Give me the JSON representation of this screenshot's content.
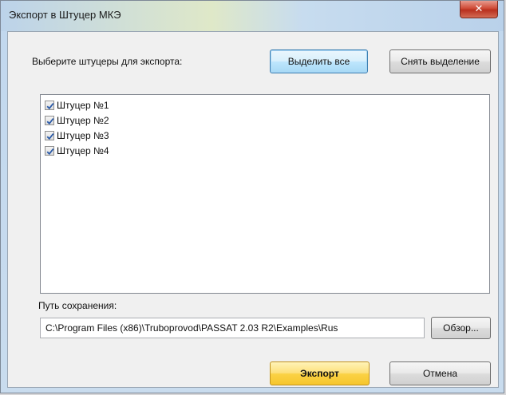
{
  "window": {
    "title": "Экспорт в Штуцер МКЭ",
    "close_glyph": "✕"
  },
  "selection": {
    "label": "Выберите штуцеры для экспорта:",
    "select_all_label": "Выделить все",
    "deselect_label": "Снять выделение"
  },
  "list": {
    "items": [
      {
        "label": "Штуцер №1",
        "checked": true
      },
      {
        "label": "Штуцер №2",
        "checked": true
      },
      {
        "label": "Штуцер №3",
        "checked": true
      },
      {
        "label": "Штуцер №4",
        "checked": true
      }
    ]
  },
  "save": {
    "label": "Путь сохранения:",
    "path_value": "C:\\Program Files (x86)\\Truboprovod\\PASSAT 2.03 R2\\Examples\\Rus",
    "browse_label": "Обзор..."
  },
  "actions": {
    "export_label": "Экспорт",
    "cancel_label": "Отмена"
  },
  "colors": {
    "accent": "#3c7fb1",
    "default_button": "#fbd245",
    "close_button": "#cf4b37"
  },
  "icons": {
    "checkbox": "checkmark-icon",
    "close": "close-icon"
  }
}
